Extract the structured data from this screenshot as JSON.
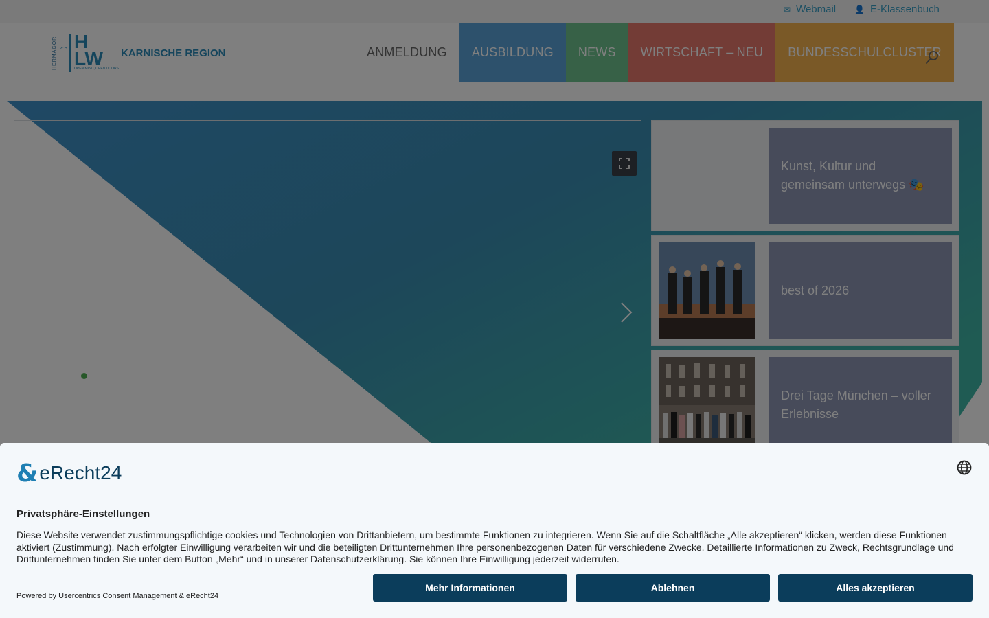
{
  "topbar": {
    "webmail": {
      "label": "Webmail",
      "icon": "mail-icon"
    },
    "klassenbuch": {
      "label": "E-Klassenbuch",
      "icon": "user-icon"
    }
  },
  "logo": {
    "vertical_text": "HERMAGOR",
    "letters_top": "H",
    "letters_bottom": "LW",
    "tagline": "OPEN MIND, OPEN DOORS",
    "region": "KARNISCHE REGION"
  },
  "nav": {
    "items": [
      {
        "label": "ANMELDUNG",
        "color": ""
      },
      {
        "label": "AUSBILDUNG",
        "color": "#5aa3d8"
      },
      {
        "label": "NEWS",
        "color": "#6ec38e"
      },
      {
        "label": "WIRTSCHAFT – NEU",
        "color": "#e7796d"
      },
      {
        "label": "BUNDESSCHULCLUSTER",
        "color": "#f4b24f"
      }
    ],
    "search_icon": "search-icon"
  },
  "posts": [
    {
      "title": "Kunst, Kultur und gemeinsam unterwegs 🎭"
    },
    {
      "title": "best of 2026"
    },
    {
      "title": "Drei Tage München – voller Erlebnisse"
    }
  ],
  "slider": {
    "fullscreen_icon": "fullscreen-icon",
    "next_icon": "chevron-right-icon"
  },
  "consent": {
    "brand": "eRecht24",
    "language_icon": "globe-icon",
    "title": "Privatsphäre-Einstellungen",
    "text": "Diese Website verwendet zustimmungspflichtige cookies und Technologien von Drittanbietern, um bestimmte Funktionen zu integrieren. Wenn Sie auf die Schaltfläche „Alle akzeptieren“ klicken, werden diese Funktionen aktiviert (Zustimmung). Nach erfolgter Einwilligung verarbeiten wir und die beteiligten Drittunternehmen Ihre personenbezogenen Daten für verschiedene Zwecke. Detaillierte Informationen zu Zweck, Rechtsgrundlage und Drittunternehmen finden Sie unter dem Button „Mehr“ und in unserer Datenschutzerklärung. Sie können Ihre Einwilligung jederzeit widerrufen.",
    "powered_by": "Powered by Usercentrics Consent Management & eRecht24",
    "buttons": {
      "more": "Mehr Informationen",
      "decline": "Ablehnen",
      "accept": "Alles akzeptieren"
    },
    "button_color": "#0b3d5b"
  }
}
